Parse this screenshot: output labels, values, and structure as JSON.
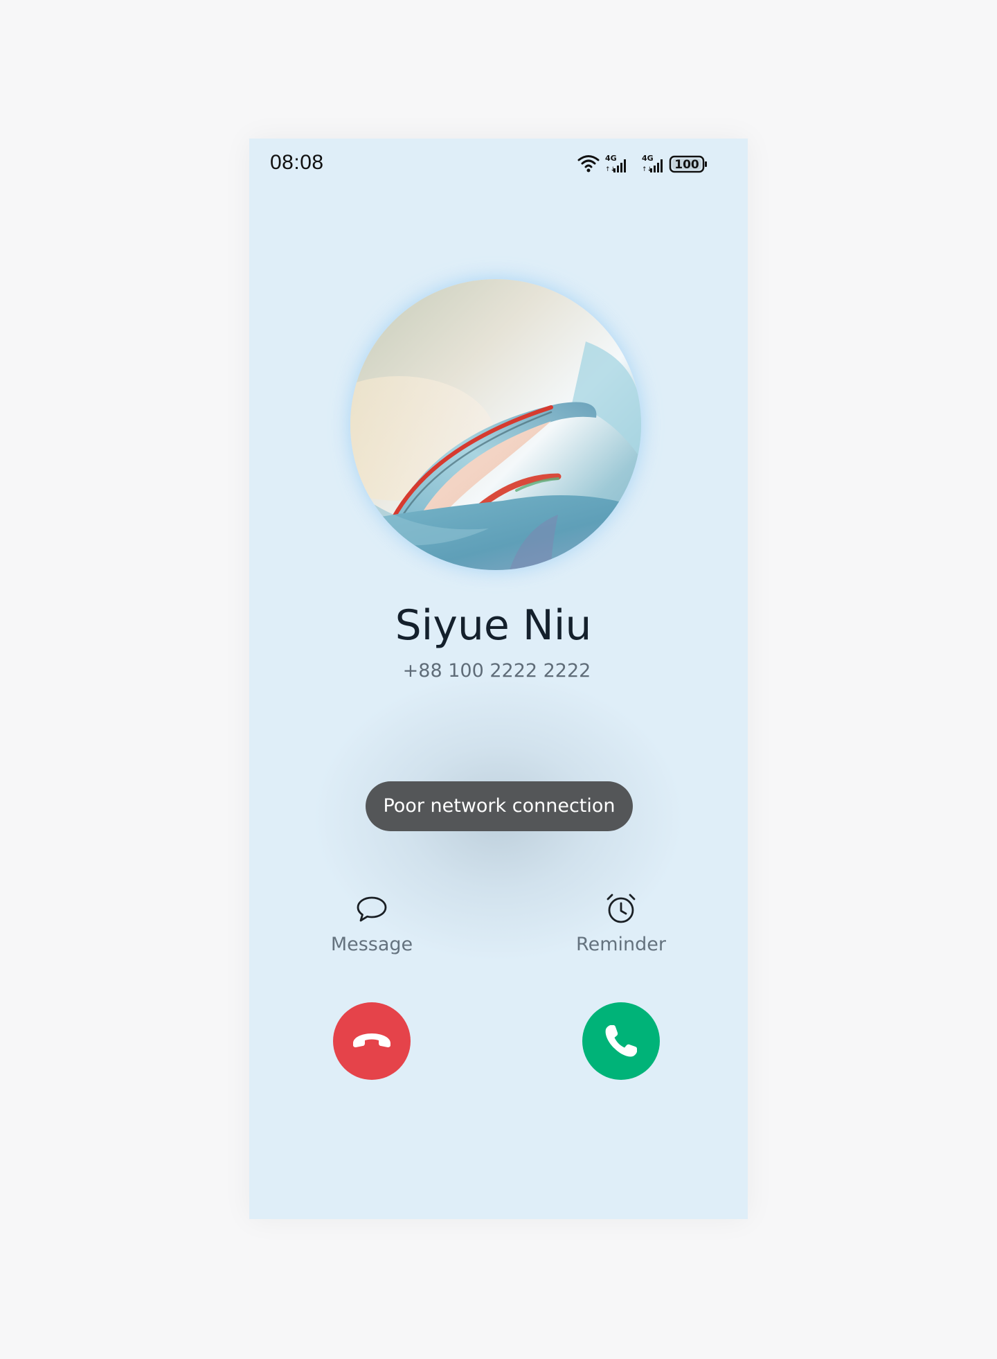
{
  "status_bar": {
    "time": "08:08",
    "battery": "100",
    "network_1": "4G",
    "network_2": "4G"
  },
  "caller": {
    "name": "Siyue Niu",
    "number": "+88 100 2222 2222"
  },
  "toast": {
    "text": "Poor network connection"
  },
  "actions": {
    "message_label": "Message",
    "reminder_label": "Reminder"
  },
  "icons": {
    "message": "message-bubble-icon",
    "reminder": "alarm-clock-icon",
    "decline": "phone-hangup-icon",
    "accept": "phone-icon"
  },
  "colors": {
    "background": "#dfeef8",
    "decline": "#e5434a",
    "accept": "#00b378",
    "toast": "#545658"
  }
}
